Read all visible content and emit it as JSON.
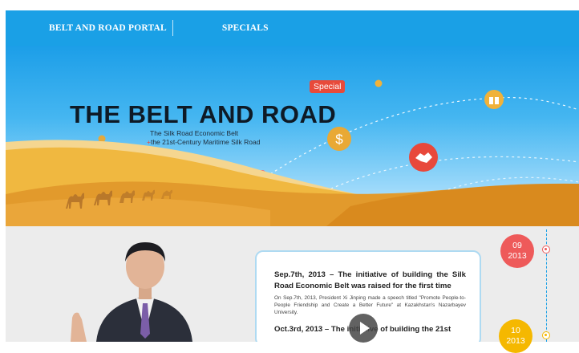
{
  "header": {
    "portal_label": "BELT AND ROAD PORTAL",
    "section_label": "SPECIALS"
  },
  "hero": {
    "badge": "Special",
    "title": "THE BELT AND ROAD",
    "subtitle_line1": "The Silk Road Economic Belt",
    "subtitle_plus": "+",
    "subtitle_line2": "the 21st-Century Maritime Silk Road",
    "icons": [
      "dollar-icon",
      "handshake-icon",
      "gift-icon",
      "camel-caravan"
    ]
  },
  "timeline": {
    "entries": [
      {
        "month": "09",
        "year": "2013"
      },
      {
        "month": "10",
        "year": "2013"
      }
    ]
  },
  "card": {
    "heading1": "Sep.7th, 2013 – The initiative of building the Silk Road Economic Belt was raised for the first time",
    "body1": "On Sep.7th, 2013, President Xi Jinping made a speech titled \"Promote People-to-People Friendship and Create a Better Future\" at Kazakhstan's Nazarbayev University.",
    "heading2": "Oct.3rd, 2013 – The initiative of building the 21st"
  },
  "colors": {
    "header_blue": "#1aa0e6",
    "badge_red": "#e84a3a",
    "date_red": "#ee5a5a",
    "date_yellow": "#f5b800",
    "sand": "#f0b23a"
  }
}
